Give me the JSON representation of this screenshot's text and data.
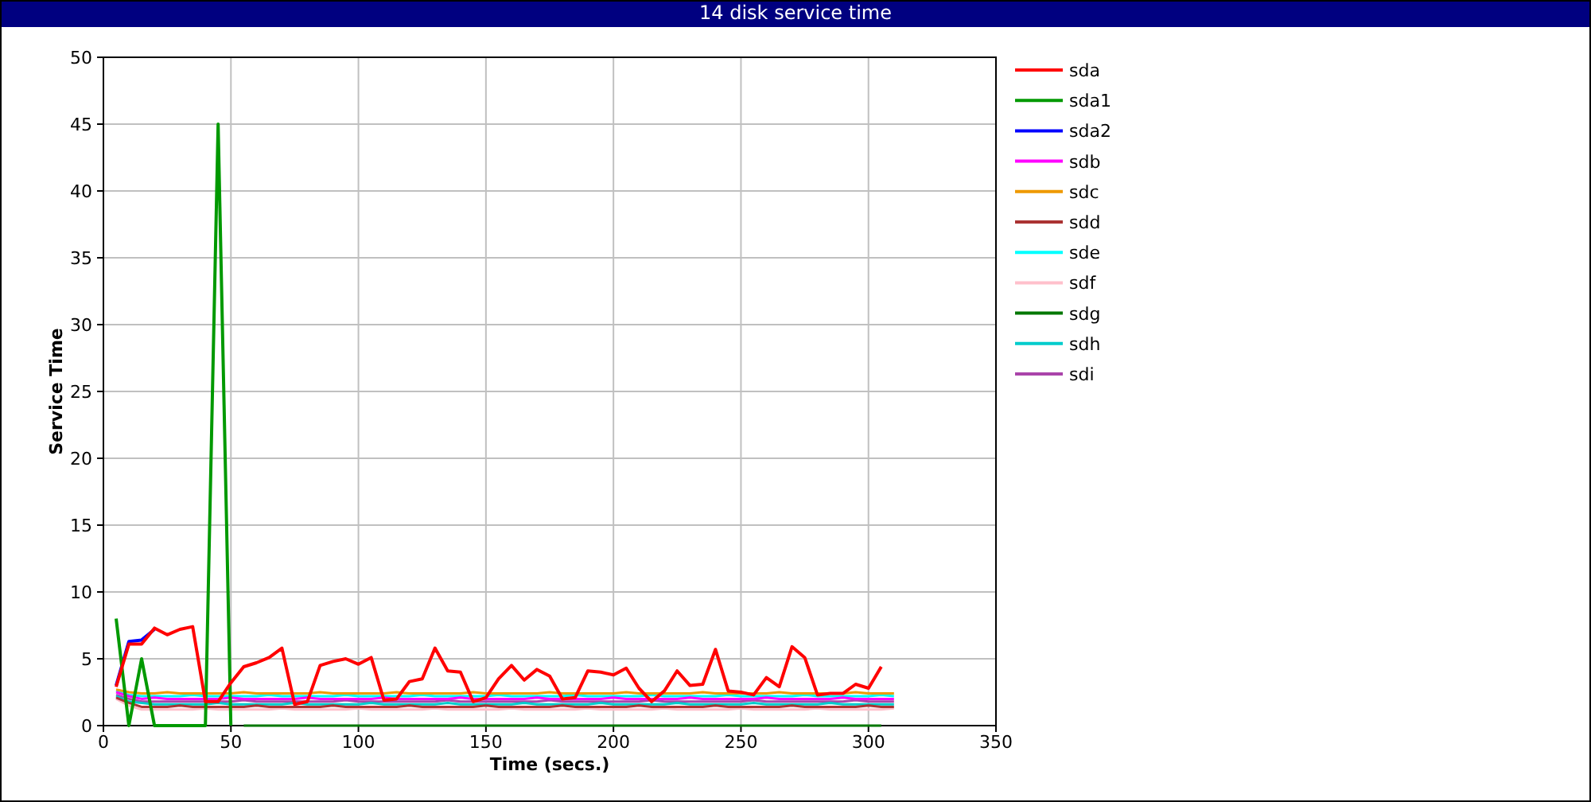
{
  "title": "14 disk service time",
  "chart_data": {
    "type": "line",
    "xlabel": "Time (secs.)",
    "ylabel": "Service Time",
    "xlim": [
      0,
      350
    ],
    "ylim": [
      0,
      50
    ],
    "xticks": [
      0,
      50,
      100,
      150,
      200,
      250,
      300,
      350
    ],
    "yticks": [
      0,
      5,
      10,
      15,
      20,
      25,
      30,
      35,
      40,
      45,
      50
    ],
    "grid": true,
    "legend": true,
    "x": [
      5,
      10,
      15,
      20,
      25,
      30,
      35,
      40,
      45,
      50,
      55,
      60,
      65,
      70,
      75,
      80,
      85,
      90,
      95,
      100,
      105,
      110,
      115,
      120,
      125,
      130,
      135,
      140,
      145,
      150,
      155,
      160,
      165,
      170,
      175,
      180,
      185,
      190,
      195,
      200,
      205,
      210,
      215,
      220,
      225,
      230,
      235,
      240,
      245,
      250,
      255,
      260,
      265,
      270,
      275,
      280,
      285,
      290,
      295,
      300,
      305,
      310
    ],
    "series": [
      {
        "name": "sda",
        "color": "#ff0000",
        "values": [
          2.9,
          6.1,
          6.1,
          7.3,
          6.8,
          7.2,
          7.4,
          1.8,
          1.8,
          3.2,
          4.4,
          4.7,
          5.1,
          5.8,
          1.6,
          1.8,
          4.5,
          4.8,
          5.0,
          4.6,
          5.1,
          1.9,
          2.0,
          3.3,
          3.5,
          5.8,
          4.1,
          4.0,
          1.8,
          2.1,
          3.5,
          4.5,
          3.4,
          4.2,
          3.7,
          2.0,
          2.1,
          4.1,
          4.0,
          3.8,
          4.3,
          2.8,
          1.8,
          2.6,
          4.1,
          3.0,
          3.1,
          5.7,
          2.6,
          2.5,
          2.3,
          3.6,
          2.9,
          5.9,
          5.1,
          2.3,
          2.4,
          2.4,
          3.1,
          2.8,
          4.4,
          null
        ]
      },
      {
        "name": "sda1",
        "color": "#009900",
        "values": [
          8.0,
          0,
          5.0,
          0,
          0,
          0,
          0,
          0,
          45.0,
          0,
          null,
          null,
          null,
          null,
          null,
          null,
          null,
          null,
          null,
          null,
          null,
          null,
          null,
          null,
          null,
          null,
          null,
          null,
          null,
          null,
          null,
          null,
          null,
          null,
          null,
          null,
          null,
          null,
          null,
          null,
          null,
          null,
          null,
          null,
          null,
          null,
          null,
          null,
          null,
          null,
          null,
          null,
          null,
          null,
          null,
          null,
          null,
          null,
          null,
          null,
          null,
          null
        ]
      },
      {
        "name": "sda2",
        "color": "#0000ff",
        "values": [
          3.0,
          6.3,
          6.4,
          7.2,
          null,
          null,
          null,
          null,
          null,
          null,
          null,
          null,
          null,
          null,
          null,
          null,
          null,
          null,
          null,
          null,
          null,
          null,
          null,
          null,
          null,
          null,
          null,
          null,
          null,
          null,
          null,
          null,
          null,
          null,
          null,
          null,
          null,
          null,
          null,
          null,
          null,
          null,
          null,
          null,
          null,
          null,
          null,
          null,
          null,
          null,
          null,
          null,
          null,
          null,
          null,
          null,
          null,
          null,
          null,
          null,
          null,
          null
        ]
      },
      {
        "name": "sdb",
        "color": "#ff00ff",
        "values": [
          2.5,
          2.2,
          2.0,
          2.1,
          2.0,
          2.0,
          2.0,
          2.0,
          2.0,
          2.1,
          2.0,
          2.0,
          2.0,
          2.0,
          2.0,
          2.1,
          2.0,
          2.0,
          2.0,
          2.0,
          2.0,
          2.1,
          2.0,
          2.0,
          2.0,
          2.0,
          2.0,
          2.1,
          2.0,
          2.0,
          2.0,
          2.0,
          2.0,
          2.1,
          2.0,
          2.0,
          2.0,
          2.0,
          2.0,
          2.1,
          2.0,
          2.0,
          2.0,
          2.0,
          2.0,
          2.1,
          2.0,
          2.0,
          2.0,
          2.0,
          2.0,
          2.1,
          2.0,
          2.0,
          2.0,
          2.0,
          2.0,
          2.1,
          2.0,
          2.0,
          2.0,
          2.0
        ]
      },
      {
        "name": "sdc",
        "color": "#ee9900",
        "values": [
          2.7,
          2.5,
          2.4,
          2.4,
          2.5,
          2.4,
          2.4,
          2.4,
          2.4,
          2.4,
          2.5,
          2.4,
          2.4,
          2.4,
          2.4,
          2.4,
          2.5,
          2.4,
          2.4,
          2.4,
          2.4,
          2.4,
          2.5,
          2.4,
          2.4,
          2.4,
          2.4,
          2.4,
          2.5,
          2.4,
          2.4,
          2.4,
          2.4,
          2.4,
          2.5,
          2.4,
          2.4,
          2.4,
          2.4,
          2.4,
          2.5,
          2.4,
          2.4,
          2.4,
          2.4,
          2.4,
          2.5,
          2.4,
          2.4,
          2.4,
          2.4,
          2.4,
          2.5,
          2.4,
          2.4,
          2.4,
          2.4,
          2.4,
          2.5,
          2.4,
          2.4,
          2.4
        ]
      },
      {
        "name": "sdd",
        "color": "#aa3333",
        "values": [
          2.1,
          1.7,
          1.4,
          1.4,
          1.4,
          1.5,
          1.4,
          1.4,
          1.4,
          1.4,
          1.4,
          1.5,
          1.4,
          1.4,
          1.4,
          1.4,
          1.4,
          1.5,
          1.4,
          1.4,
          1.4,
          1.4,
          1.4,
          1.5,
          1.4,
          1.4,
          1.4,
          1.4,
          1.4,
          1.5,
          1.4,
          1.4,
          1.4,
          1.4,
          1.4,
          1.5,
          1.4,
          1.4,
          1.4,
          1.4,
          1.4,
          1.5,
          1.4,
          1.4,
          1.4,
          1.4,
          1.4,
          1.5,
          1.4,
          1.4,
          1.4,
          1.4,
          1.4,
          1.5,
          1.4,
          1.4,
          1.4,
          1.4,
          1.4,
          1.5,
          1.4,
          1.4
        ]
      },
      {
        "name": "sde",
        "color": "#00ffff",
        "values": [
          2.6,
          2.3,
          2.2,
          2.2,
          2.2,
          2.2,
          2.3,
          2.2,
          2.2,
          2.2,
          2.2,
          2.2,
          2.3,
          2.2,
          2.2,
          2.2,
          2.2,
          2.2,
          2.3,
          2.2,
          2.2,
          2.2,
          2.2,
          2.2,
          2.3,
          2.2,
          2.2,
          2.2,
          2.2,
          2.2,
          2.3,
          2.2,
          2.2,
          2.2,
          2.2,
          2.2,
          2.3,
          2.2,
          2.2,
          2.2,
          2.2,
          2.2,
          2.3,
          2.2,
          2.2,
          2.2,
          2.2,
          2.2,
          2.3,
          2.2,
          2.2,
          2.2,
          2.2,
          2.2,
          2.3,
          2.2,
          2.2,
          2.2,
          2.2,
          2.2,
          2.3,
          2.2
        ]
      },
      {
        "name": "sdf",
        "color": "#ffc0cb",
        "values": [
          2.0,
          1.5,
          1.2,
          1.2,
          1.2,
          1.2,
          1.2,
          1.3,
          1.2,
          1.2,
          1.2,
          1.2,
          1.2,
          1.3,
          1.2,
          1.2,
          1.2,
          1.2,
          1.2,
          1.3,
          1.2,
          1.2,
          1.2,
          1.2,
          1.2,
          1.3,
          1.2,
          1.2,
          1.2,
          1.2,
          1.2,
          1.3,
          1.2,
          1.2,
          1.2,
          1.2,
          1.2,
          1.3,
          1.2,
          1.2,
          1.2,
          1.2,
          1.2,
          1.3,
          1.2,
          1.2,
          1.2,
          1.2,
          1.2,
          1.3,
          1.2,
          1.2,
          1.2,
          1.2,
          1.2,
          1.3,
          1.2,
          1.2,
          1.2,
          1.2,
          1.2,
          1.3
        ]
      },
      {
        "name": "sdg",
        "color": "#007700",
        "values": [
          null,
          null,
          null,
          null,
          null,
          null,
          null,
          null,
          null,
          null,
          0,
          0,
          0,
          0,
          0,
          0,
          0,
          0,
          0,
          0,
          0,
          0,
          0,
          0,
          0,
          0,
          0,
          0,
          0,
          0,
          0,
          0,
          0,
          0,
          0,
          0,
          0,
          0,
          0,
          0,
          0,
          0,
          0,
          0,
          0,
          0,
          0,
          0,
          0,
          0,
          0,
          0,
          0,
          0,
          0,
          0,
          0,
          0,
          0,
          0,
          0,
          null
        ]
      },
      {
        "name": "sdh",
        "color": "#00cccc",
        "values": [
          2.2,
          1.8,
          1.7,
          1.6,
          1.6,
          1.6,
          1.6,
          1.6,
          1.7,
          1.6,
          1.6,
          1.6,
          1.6,
          1.6,
          1.7,
          1.6,
          1.6,
          1.6,
          1.6,
          1.6,
          1.7,
          1.6,
          1.6,
          1.6,
          1.6,
          1.6,
          1.7,
          1.6,
          1.6,
          1.6,
          1.6,
          1.6,
          1.7,
          1.6,
          1.6,
          1.6,
          1.6,
          1.6,
          1.7,
          1.6,
          1.6,
          1.6,
          1.6,
          1.6,
          1.7,
          1.6,
          1.6,
          1.6,
          1.6,
          1.6,
          1.7,
          1.6,
          1.6,
          1.6,
          1.6,
          1.6,
          1.7,
          1.6,
          1.6,
          1.6,
          1.6,
          1.6
        ]
      },
      {
        "name": "sdi",
        "color": "#aa44aa",
        "values": [
          2.3,
          2.0,
          1.8,
          1.8,
          1.8,
          1.8,
          1.8,
          1.8,
          1.8,
          1.8,
          1.9,
          1.8,
          1.8,
          1.8,
          1.8,
          1.8,
          1.8,
          1.8,
          1.9,
          1.8,
          1.8,
          1.8,
          1.8,
          1.8,
          1.8,
          1.8,
          1.9,
          1.8,
          1.8,
          1.8,
          1.8,
          1.8,
          1.8,
          1.8,
          1.9,
          1.8,
          1.8,
          1.8,
          1.8,
          1.8,
          1.8,
          1.8,
          1.9,
          1.8,
          1.8,
          1.8,
          1.8,
          1.8,
          1.8,
          1.8,
          1.9,
          1.8,
          1.8,
          1.8,
          1.8,
          1.8,
          1.8,
          1.8,
          1.9,
          1.8,
          1.8,
          1.8
        ]
      }
    ]
  }
}
